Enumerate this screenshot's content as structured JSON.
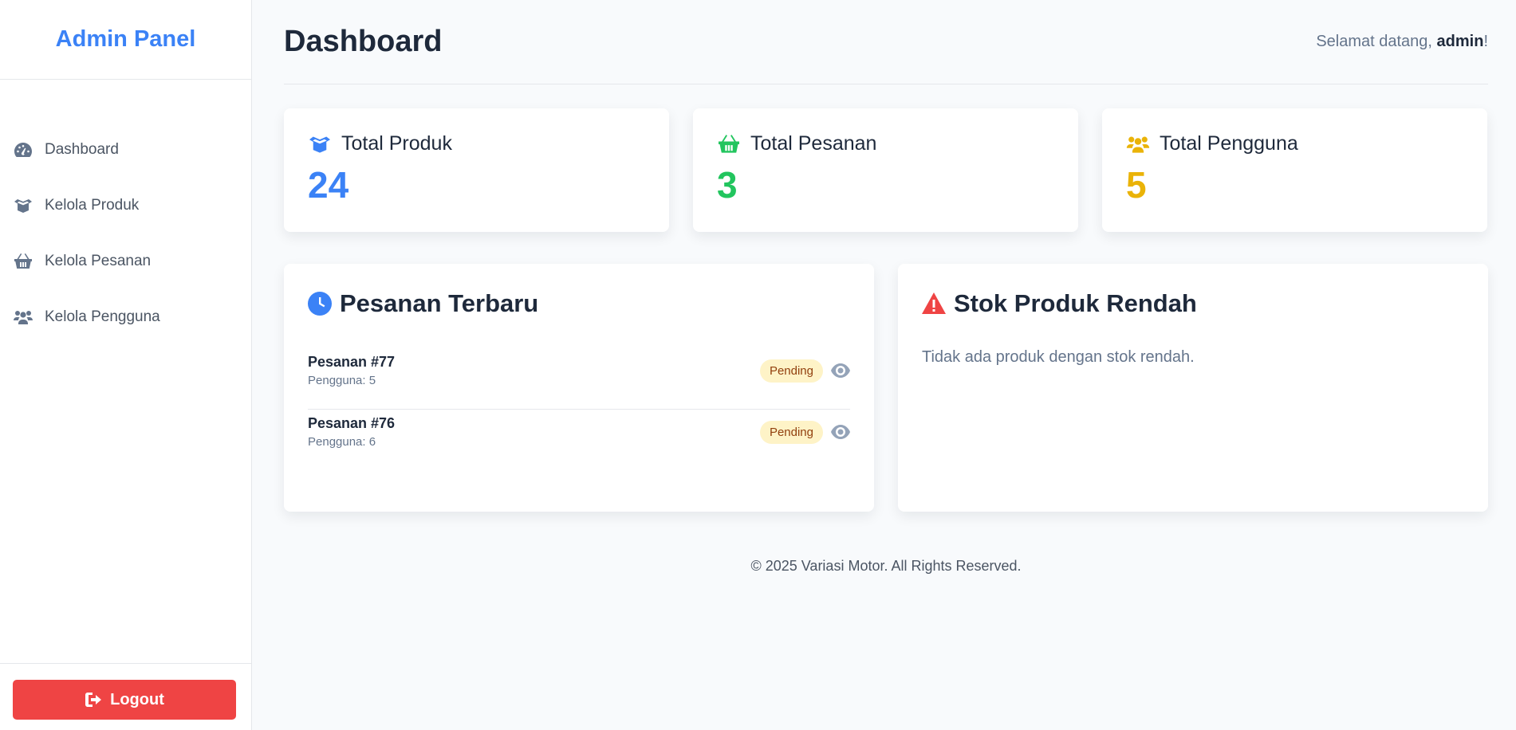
{
  "sidebar": {
    "brand": "Admin Panel",
    "items": [
      {
        "label": "Dashboard",
        "icon": "gauge-icon"
      },
      {
        "label": "Kelola Produk",
        "icon": "box-open-icon"
      },
      {
        "label": "Kelola Pesanan",
        "icon": "basket-icon"
      },
      {
        "label": "Kelola Pengguna",
        "icon": "users-icon"
      }
    ],
    "logout_label": "Logout"
  },
  "header": {
    "title": "Dashboard",
    "welcome_prefix": "Selamat datang, ",
    "username": "admin",
    "welcome_suffix": "!"
  },
  "stats": [
    {
      "label": "Total Produk",
      "value": "24",
      "color": "#3b82f6",
      "icon": "box-open-icon"
    },
    {
      "label": "Total Pesanan",
      "value": "3",
      "color": "#22c55e",
      "icon": "basket-icon"
    },
    {
      "label": "Total Pengguna",
      "value": "5",
      "color": "#eab308",
      "icon": "users-icon"
    }
  ],
  "recent_orders": {
    "title": "Pesanan Terbaru",
    "icon": "clock-icon",
    "orders": [
      {
        "id": "Pesanan #77",
        "user": "Pengguna: 5",
        "status": "Pending"
      },
      {
        "id": "Pesanan #76",
        "user": "Pengguna: 6",
        "status": "Pending"
      }
    ]
  },
  "low_stock": {
    "title": "Stok Produk Rendah",
    "icon": "warning-icon",
    "empty_text": "Tidak ada produk dengan stok rendah."
  },
  "footer": "© 2025 Variasi Motor. All Rights Reserved.",
  "colors": {
    "accent": "#3b82f6",
    "danger": "#ef4444",
    "success": "#22c55e",
    "warning": "#eab308"
  }
}
